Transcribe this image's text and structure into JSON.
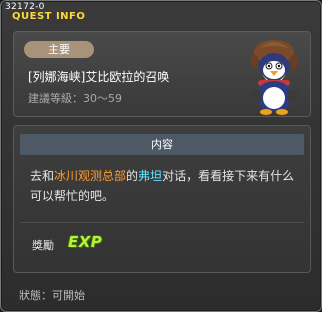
{
  "window": {
    "quest_id": "32172-0",
    "title": "QUEST INFO"
  },
  "quest": {
    "badge": "主要",
    "name": "[列娜海峡]艾比欧拉的召唤",
    "level": "建議等級：30～59"
  },
  "content": {
    "header": "内容",
    "text_parts": {
      "p1": "去和",
      "place": "冰川观测总部",
      "p2": "的",
      "npc": "弗坦",
      "p3": "对话，看看接下来有什么可以帮忙的吧。"
    },
    "reward_label": "獎勵",
    "reward_icon_text": "EXP"
  },
  "status": "狀態：可開始",
  "colors": {
    "title": "#ffd83a",
    "place_highlight": "#ff9b2f",
    "npc_highlight": "#5fe6ff",
    "exp": "#b6f238",
    "badge": "#a8937a",
    "content_header": "#4d5a66"
  },
  "icons": {
    "npc": "penguin-explorer-npc-icon",
    "reward": "exp-icon"
  }
}
